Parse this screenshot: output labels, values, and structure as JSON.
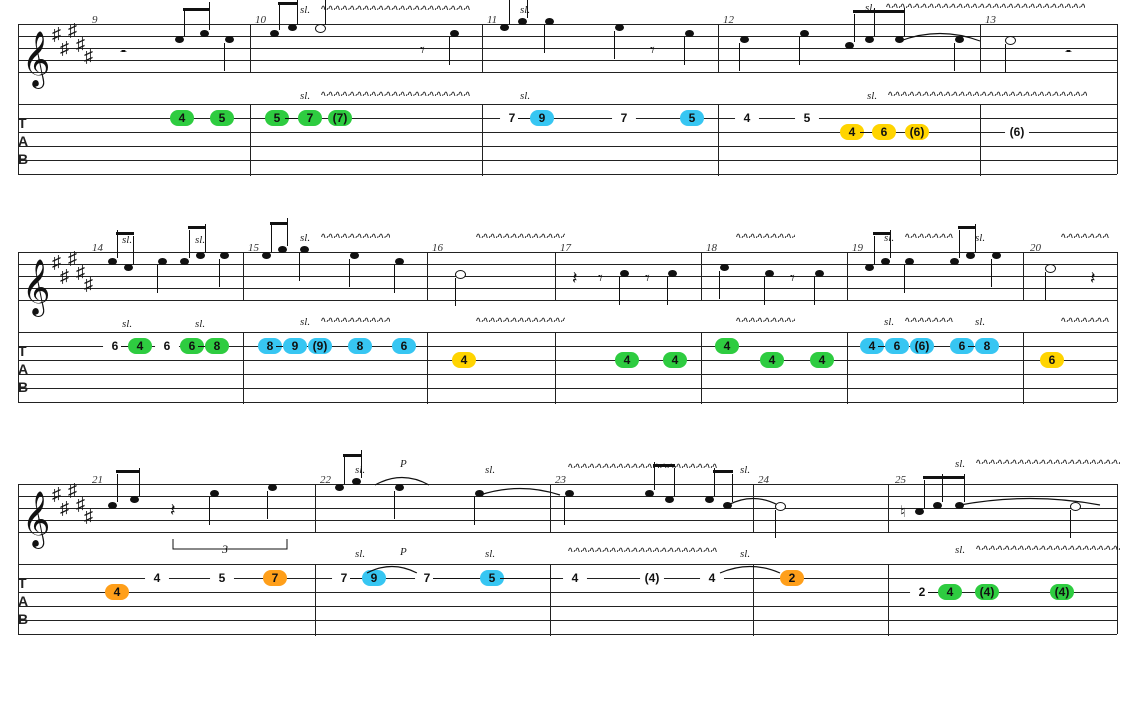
{
  "tab_label": {
    "t": "T",
    "a": "A",
    "b": "B"
  },
  "technique": {
    "slide": "sl.",
    "pull": "P",
    "triplet": "3"
  },
  "wavy_fill": "∿∿∿∿∿∿∿∿∿∿∿∿∿∿∿∿∿∿∿∿∿∿∿∿∿∿∿∿∿∿∿∿∿∿∿∿∿∿∿∿∿∿∿∿∿∿∿∿∿∿∿∿∿∿",
  "systems": [
    {
      "measure_numbers": [
        "9",
        "10",
        "11",
        "12",
        "13"
      ],
      "notation_slides": [
        "sl.",
        "sl.",
        "sl."
      ],
      "tab_slides": [
        "sl.",
        "sl.",
        "sl."
      ],
      "tab_notes": [
        {
          "id": "s1n1",
          "string": 2,
          "fret": "4",
          "color": "green"
        },
        {
          "id": "s1n2",
          "string": 2,
          "fret": "5",
          "color": "green"
        },
        {
          "id": "s1n3",
          "string": 2,
          "fret": "5",
          "color": "green"
        },
        {
          "id": "s1n4",
          "string": 2,
          "fret": "7",
          "color": "green"
        },
        {
          "id": "s1n5",
          "string": 2,
          "fret": "(7)",
          "color": "green"
        },
        {
          "id": "s1n6",
          "string": 2,
          "fret": "7",
          "color": "plain"
        },
        {
          "id": "s1n7",
          "string": 2,
          "fret": "9",
          "color": "cyan"
        },
        {
          "id": "s1n8",
          "string": 2,
          "fret": "7",
          "color": "plain"
        },
        {
          "id": "s1n9",
          "string": 2,
          "fret": "5",
          "color": "cyan"
        },
        {
          "id": "s1n10",
          "string": 2,
          "fret": "4",
          "color": "plain"
        },
        {
          "id": "s1n11",
          "string": 2,
          "fret": "5",
          "color": "plain"
        },
        {
          "id": "s1n12",
          "string": 3,
          "fret": "4",
          "color": "yellow"
        },
        {
          "id": "s1n13",
          "string": 3,
          "fret": "6",
          "color": "yellow"
        },
        {
          "id": "s1n14",
          "string": 3,
          "fret": "(6)",
          "color": "yellow"
        },
        {
          "id": "s1n15",
          "string": 3,
          "fret": "(6)",
          "color": "plain"
        }
      ]
    },
    {
      "measure_numbers": [
        "14",
        "15",
        "16",
        "17",
        "18",
        "19",
        "20"
      ],
      "notation_slides": [
        "sl.",
        "sl.",
        "sl.",
        "sl.",
        "sl."
      ],
      "tab_slides": [
        "sl.",
        "sl.",
        "sl.",
        "sl.",
        "sl."
      ],
      "tab_notes": [
        {
          "id": "s2n1",
          "string": 2,
          "fret": "6",
          "color": "plain"
        },
        {
          "id": "s2n2",
          "string": 2,
          "fret": "4",
          "color": "green"
        },
        {
          "id": "s2n3",
          "string": 2,
          "fret": "6",
          "color": "plain"
        },
        {
          "id": "s2n4",
          "string": 2,
          "fret": "6",
          "color": "green"
        },
        {
          "id": "s2n5",
          "string": 2,
          "fret": "8",
          "color": "green"
        },
        {
          "id": "s2n6",
          "string": 2,
          "fret": "8",
          "color": "cyan"
        },
        {
          "id": "s2n7",
          "string": 2,
          "fret": "9",
          "color": "cyan"
        },
        {
          "id": "s2n8",
          "string": 2,
          "fret": "(9)",
          "color": "cyan"
        },
        {
          "id": "s2n9",
          "string": 2,
          "fret": "8",
          "color": "cyan"
        },
        {
          "id": "s2n10",
          "string": 2,
          "fret": "6",
          "color": "cyan"
        },
        {
          "id": "s2n11",
          "string": 3,
          "fret": "4",
          "color": "yellow"
        },
        {
          "id": "s2n12",
          "string": 3,
          "fret": "4",
          "color": "green"
        },
        {
          "id": "s2n13",
          "string": 3,
          "fret": "4",
          "color": "green"
        },
        {
          "id": "s2n14",
          "string": 2,
          "fret": "4",
          "color": "green"
        },
        {
          "id": "s2n15",
          "string": 3,
          "fret": "4",
          "color": "green"
        },
        {
          "id": "s2n16",
          "string": 3,
          "fret": "4",
          "color": "green"
        },
        {
          "id": "s2n17",
          "string": 2,
          "fret": "4",
          "color": "cyan"
        },
        {
          "id": "s2n18",
          "string": 2,
          "fret": "6",
          "color": "cyan"
        },
        {
          "id": "s2n19",
          "string": 2,
          "fret": "(6)",
          "color": "cyan"
        },
        {
          "id": "s2n20",
          "string": 2,
          "fret": "6",
          "color": "cyan"
        },
        {
          "id": "s2n21",
          "string": 2,
          "fret": "8",
          "color": "cyan"
        },
        {
          "id": "s2n22",
          "string": 3,
          "fret": "6",
          "color": "yellow"
        }
      ]
    },
    {
      "measure_numbers": [
        "21",
        "22",
        "23",
        "24",
        "25"
      ],
      "notation_slides": [
        "sl.",
        "sl.",
        "sl.",
        "sl."
      ],
      "p_label": "P",
      "triplet": "3",
      "tab_slides": [
        "sl.",
        "P",
        "sl.",
        "sl.",
        "sl."
      ],
      "tab_notes": [
        {
          "id": "s3n1",
          "string": 3,
          "fret": "4",
          "color": "orange"
        },
        {
          "id": "s3n2",
          "string": 2,
          "fret": "4",
          "color": "plain"
        },
        {
          "id": "s3n3",
          "string": 2,
          "fret": "5",
          "color": "plain"
        },
        {
          "id": "s3n4",
          "string": 2,
          "fret": "7",
          "color": "orange"
        },
        {
          "id": "s3n5",
          "string": 2,
          "fret": "7",
          "color": "plain"
        },
        {
          "id": "s3n6",
          "string": 2,
          "fret": "9",
          "color": "cyan"
        },
        {
          "id": "s3n7",
          "string": 2,
          "fret": "7",
          "color": "plain"
        },
        {
          "id": "s3n8",
          "string": 2,
          "fret": "5",
          "color": "cyan"
        },
        {
          "id": "s3n9",
          "string": 2,
          "fret": "4",
          "color": "plain"
        },
        {
          "id": "s3n10",
          "string": 2,
          "fret": "(4)",
          "color": "plain"
        },
        {
          "id": "s3n11",
          "string": 2,
          "fret": "4",
          "color": "plain"
        },
        {
          "id": "s3n12",
          "string": 2,
          "fret": "2",
          "color": "orange"
        },
        {
          "id": "s3n13",
          "string": 3,
          "fret": "2",
          "color": "plain"
        },
        {
          "id": "s3n14",
          "string": 3,
          "fret": "4",
          "color": "green"
        },
        {
          "id": "s3n15",
          "string": 3,
          "fret": "(4)",
          "color": "green"
        },
        {
          "id": "s3n16",
          "string": 3,
          "fret": "(4)",
          "color": "green"
        }
      ]
    }
  ]
}
